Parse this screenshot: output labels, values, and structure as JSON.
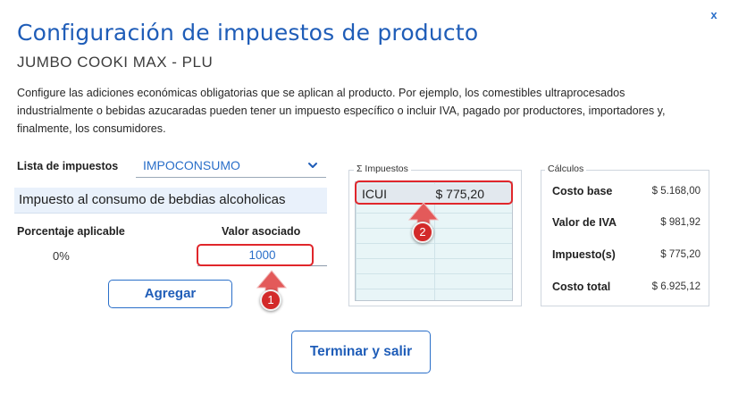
{
  "dialog": {
    "title": "Configuración de impuestos de producto",
    "subtitle": "JUMBO COOKI MAX - PLU",
    "description": "Configure las adiciones económicas obligatorias que se aplican al producto. Por ejemplo, los comestibles ultraprocesados industrialmente o bebidas azucaradas pueden tener un impuesto específico o incluir IVA, pagado por productores, importadores y, finalmente, los consumidores.",
    "close_label": "x"
  },
  "form": {
    "lista_label": "Lista de impuestos",
    "lista_value": "IMPOCONSUMO",
    "tax_name": "Impuesto al consumo de bebdias alcoholicas",
    "pct_label": "Porcentaje aplicable",
    "pct_value": "0%",
    "val_label": "Valor asociado",
    "val_value": "1000",
    "add_button": "Agregar",
    "finish_button": "Terminar y salir"
  },
  "taxes": {
    "legend": "Σ Impuestos",
    "rows": [
      {
        "name": "ICUI",
        "amount": "$ 775,20"
      }
    ]
  },
  "calc": {
    "legend": "Cálculos",
    "rows": [
      {
        "label": "Costo base",
        "value": "$ 5.168,00"
      },
      {
        "label": "Valor de IVA",
        "value": "$ 981,92"
      },
      {
        "label": "Impuesto(s)",
        "value": "$ 775,20"
      },
      {
        "label": "Costo total",
        "value": "$ 6.925,12"
      }
    ]
  },
  "annotations": {
    "marker_1": "1",
    "marker_2": "2"
  },
  "colors": {
    "accent": "#1f5db8",
    "highlight": "#e0262b",
    "marker": "#d32a2a"
  },
  "icons": {
    "dropdown": "chevron-down-icon",
    "close": "close-icon"
  }
}
